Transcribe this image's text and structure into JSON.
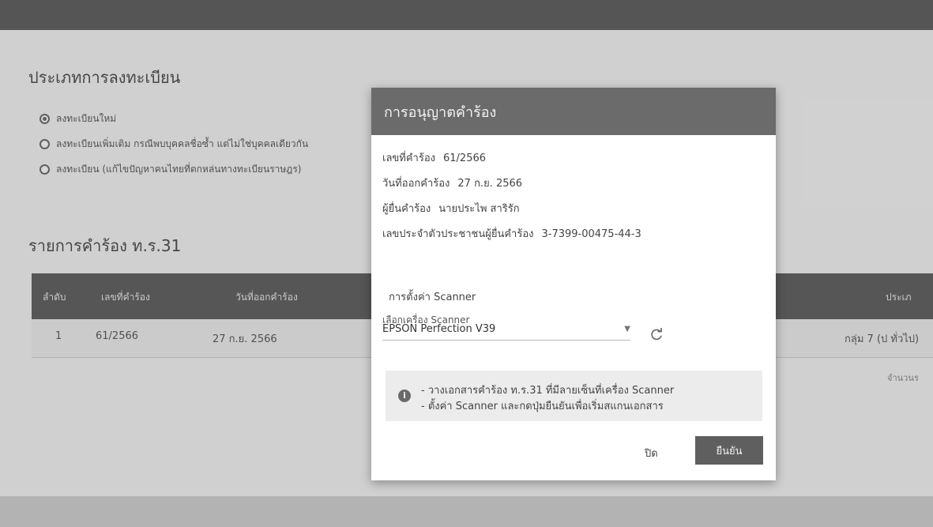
{
  "registration": {
    "title": "ประเภทการลงทะเบียน",
    "options": [
      {
        "label": "ลงทะเบียนใหม่",
        "selected": true
      },
      {
        "label": "ลงทะเบียนเพิ่มเติม กรณีพบบุคคลชื่อซ้ำ แต่ไม่ใช่บุคคลเดียวกัน",
        "selected": false
      },
      {
        "label": "ลงทะเบียน (แก้ไขปัญหาคนไทยที่ตกหล่นทางทะเบียนราษฎร)",
        "selected": false
      }
    ]
  },
  "requests": {
    "title": "รายการคำร้อง ท.ร.31",
    "columns": [
      "ลำดับ",
      "เลขที่คำร้อง",
      "วันที่ออกคำร้อง",
      "ประเภ"
    ],
    "rows": [
      {
        "no": "1",
        "request_no": "61/2566",
        "date": "27 ก.ย. 2566",
        "type": "กลุ่ม 7 (ป ทั่วไป)"
      }
    ],
    "footer_note": "จำนวนร"
  },
  "modal": {
    "title": "การอนุญาตคำร้อง",
    "fields": [
      {
        "label": "เลขที่คำร้อง",
        "value": "61/2566"
      },
      {
        "label": "วันที่ออกคำร้อง",
        "value": "27 ก.ย. 2566"
      },
      {
        "label": "ผู้ยื่นคำร้อง",
        "value": "นายประไพ สาริรัก"
      },
      {
        "label": "เลขประจำตัวประชาชนผู้ยื่นคำร้อง",
        "value": "3-7399-00475-44-3"
      }
    ],
    "scanner_section_title": "การตั้งค่า Scanner",
    "scanner_select_label": "เลือกเครื่อง Scanner",
    "scanner_selected": "EPSON Perfection V39",
    "notice_lines": [
      "- วางเอกสารคำร้อง ท.ร.31 ที่มีลายเซ็นที่เครื่อง Scanner",
      "- ตั้งค่า Scanner และกดปุ่มยืนยันเพื่อเริ่มสแกนเอกสาร"
    ],
    "close_label": "ปิด",
    "confirm_label": "ยืนยัน"
  },
  "icons": {
    "radio": "radio-icon",
    "dropdown": "chevron-down-icon",
    "refresh": "refresh-icon",
    "info": "info-icon"
  }
}
